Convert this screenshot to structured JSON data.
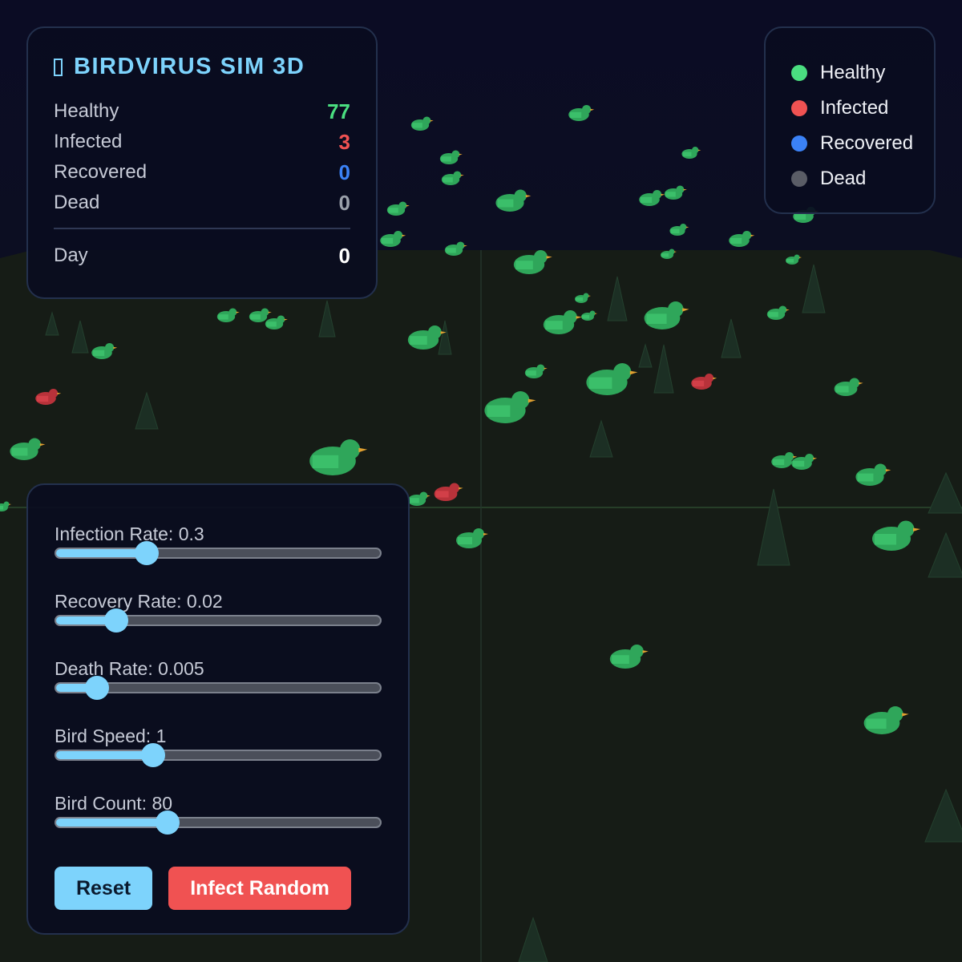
{
  "colors": {
    "healthy": "#4ade80",
    "infected": "#f05252",
    "recovered": "#3b82f6",
    "dead": "#5a5d66",
    "accent": "#7dd3fc",
    "sky": "#0a0b1f",
    "ground": "#161c16"
  },
  "stats": {
    "title_icon": "glyph-box-icon",
    "title": "BIRDVIRUS SIM 3D",
    "healthy_label": "Healthy",
    "healthy_value": "77",
    "infected_label": "Infected",
    "infected_value": "3",
    "recovered_label": "Recovered",
    "recovered_value": "0",
    "dead_label": "Dead",
    "dead_value": "0",
    "day_label": "Day",
    "day_value": "0"
  },
  "legend": {
    "items": [
      {
        "label": "Healthy",
        "color": "#4ade80"
      },
      {
        "label": "Infected",
        "color": "#f05252"
      },
      {
        "label": "Recovered",
        "color": "#3b82f6"
      },
      {
        "label": "Dead",
        "color": "#5a5d66"
      }
    ]
  },
  "controls": {
    "sliders": [
      {
        "label": "Infection Rate: 0.3",
        "level": 0.28
      },
      {
        "label": "Recovery Rate: 0.02",
        "level": 0.185
      },
      {
        "label": "Death Rate: 0.005",
        "level": 0.125
      },
      {
        "label": "Bird Speed: 1",
        "level": 0.3
      },
      {
        "label": "Bird Count: 80",
        "level": 0.345
      }
    ],
    "reset_label": "Reset",
    "infect_label": "Infect Random"
  },
  "scene": {
    "birds_healthy": 77,
    "birds_infected": 3
  }
}
